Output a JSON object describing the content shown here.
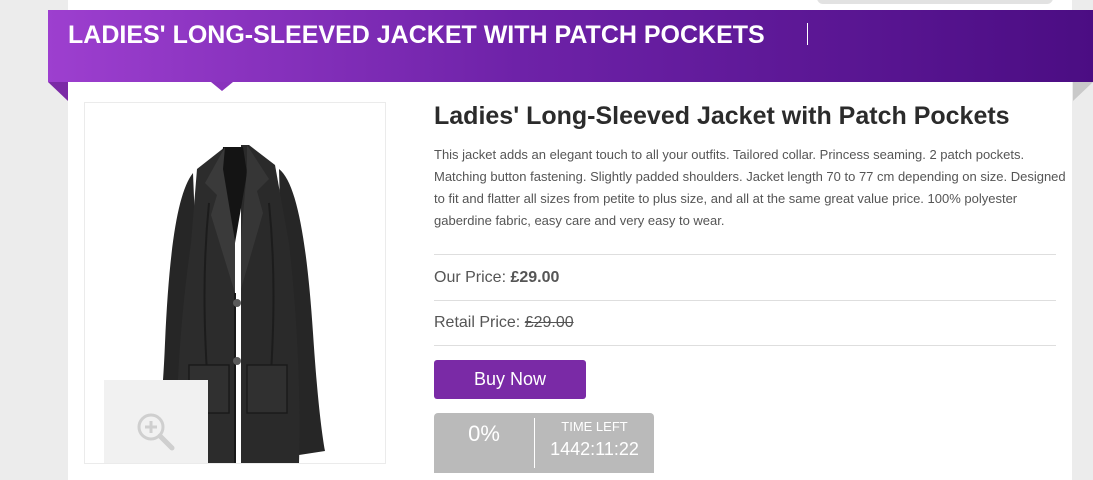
{
  "banner": {
    "title": "LADIES' LONG-SLEEVED JACKET WITH PATCH POCKETS"
  },
  "product": {
    "title": "Ladies' Long-Sleeved Jacket with Patch Pockets",
    "description": "This jacket adds an elegant touch to all your outfits. Tailored collar. Princess seaming. 2 patch pockets. Matching button fastening. Slightly padded shoulders. Jacket length 70 to 77 cm depending on size. Designed to fit and flatter all sizes from petite to plus size, and all at the same great value price. 100% polyester gaberdine fabric, easy care and very easy to wear."
  },
  "pricing": {
    "our_label": "Our Price:",
    "our_value": "£29.00",
    "retail_label": "Retail Price:",
    "retail_value": "£29.00"
  },
  "actions": {
    "buy_label": "Buy Now"
  },
  "deal": {
    "percent": "0%",
    "time_label": "TIME LEFT",
    "time_value": "1442:11:22"
  },
  "icons": {
    "zoom": "zoom-in-icon"
  },
  "colors": {
    "banner_start": "#9d3fcf",
    "banner_end": "#4b0d83",
    "button": "#7a2aa6",
    "deal_box": "#bababa"
  }
}
